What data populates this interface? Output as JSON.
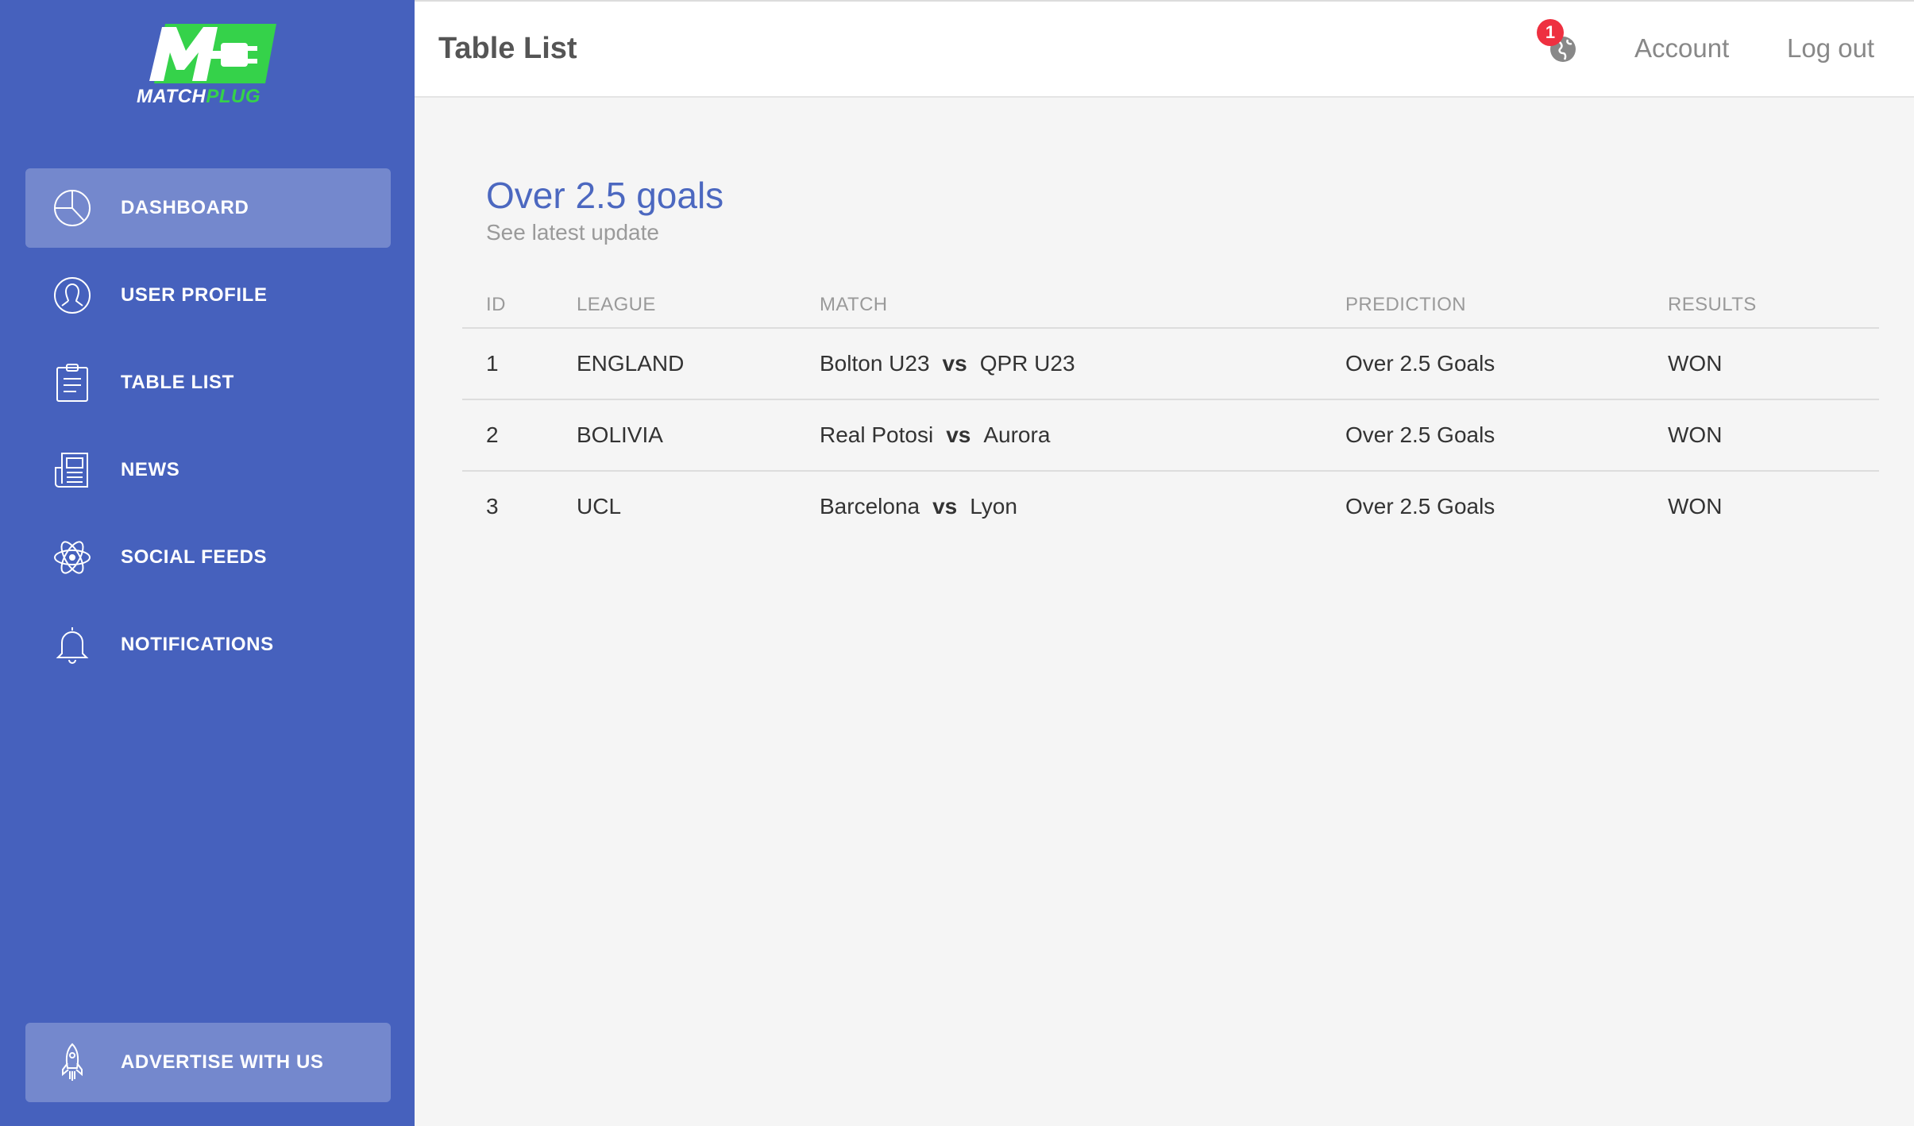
{
  "brand": {
    "logo_part1": "MATCH",
    "logo_part2": "PLUG",
    "logo_letter": "M"
  },
  "colors": {
    "sidebar": "#4661bd",
    "accent_green": "#35d24a",
    "title_blue": "#4c68c0",
    "badge_red": "#ee3040"
  },
  "sidebar": {
    "items": [
      {
        "label": "DASHBOARD",
        "icon": "pie-chart-icon",
        "active": true
      },
      {
        "label": "USER PROFILE",
        "icon": "user-icon",
        "active": false
      },
      {
        "label": "TABLE LIST",
        "icon": "clipboard-icon",
        "active": false
      },
      {
        "label": "NEWS",
        "icon": "newspaper-icon",
        "active": false
      },
      {
        "label": "SOCIAL FEEDS",
        "icon": "atom-icon",
        "active": false
      },
      {
        "label": "NOTIFICATIONS",
        "icon": "bell-icon",
        "active": false
      }
    ],
    "advertise": {
      "label": "ADVERTISE WITH US",
      "icon": "rocket-icon"
    }
  },
  "header": {
    "title": "Table List",
    "notification_count": "1",
    "globe_icon": "globe-icon",
    "account_label": "Account",
    "logout_label": "Log out"
  },
  "main": {
    "title": "Over 2.5 goals",
    "subtitle": "See latest update",
    "table": {
      "columns": [
        "ID",
        "LEAGUE",
        "MATCH",
        "PREDICTION",
        "RESULTS"
      ],
      "vs_label": "vs",
      "rows": [
        {
          "id": "1",
          "league": "ENGLAND",
          "home": "Bolton U23",
          "away": "QPR U23",
          "prediction": "Over 2.5 Goals",
          "result": "WON"
        },
        {
          "id": "2",
          "league": "BOLIVIA",
          "home": "Real Potosi",
          "away": "Aurora",
          "prediction": "Over 2.5 Goals",
          "result": "WON"
        },
        {
          "id": "3",
          "league": "UCL",
          "home": "Barcelona",
          "away": "Lyon",
          "prediction": "Over 2.5 Goals",
          "result": "WON"
        }
      ]
    }
  }
}
